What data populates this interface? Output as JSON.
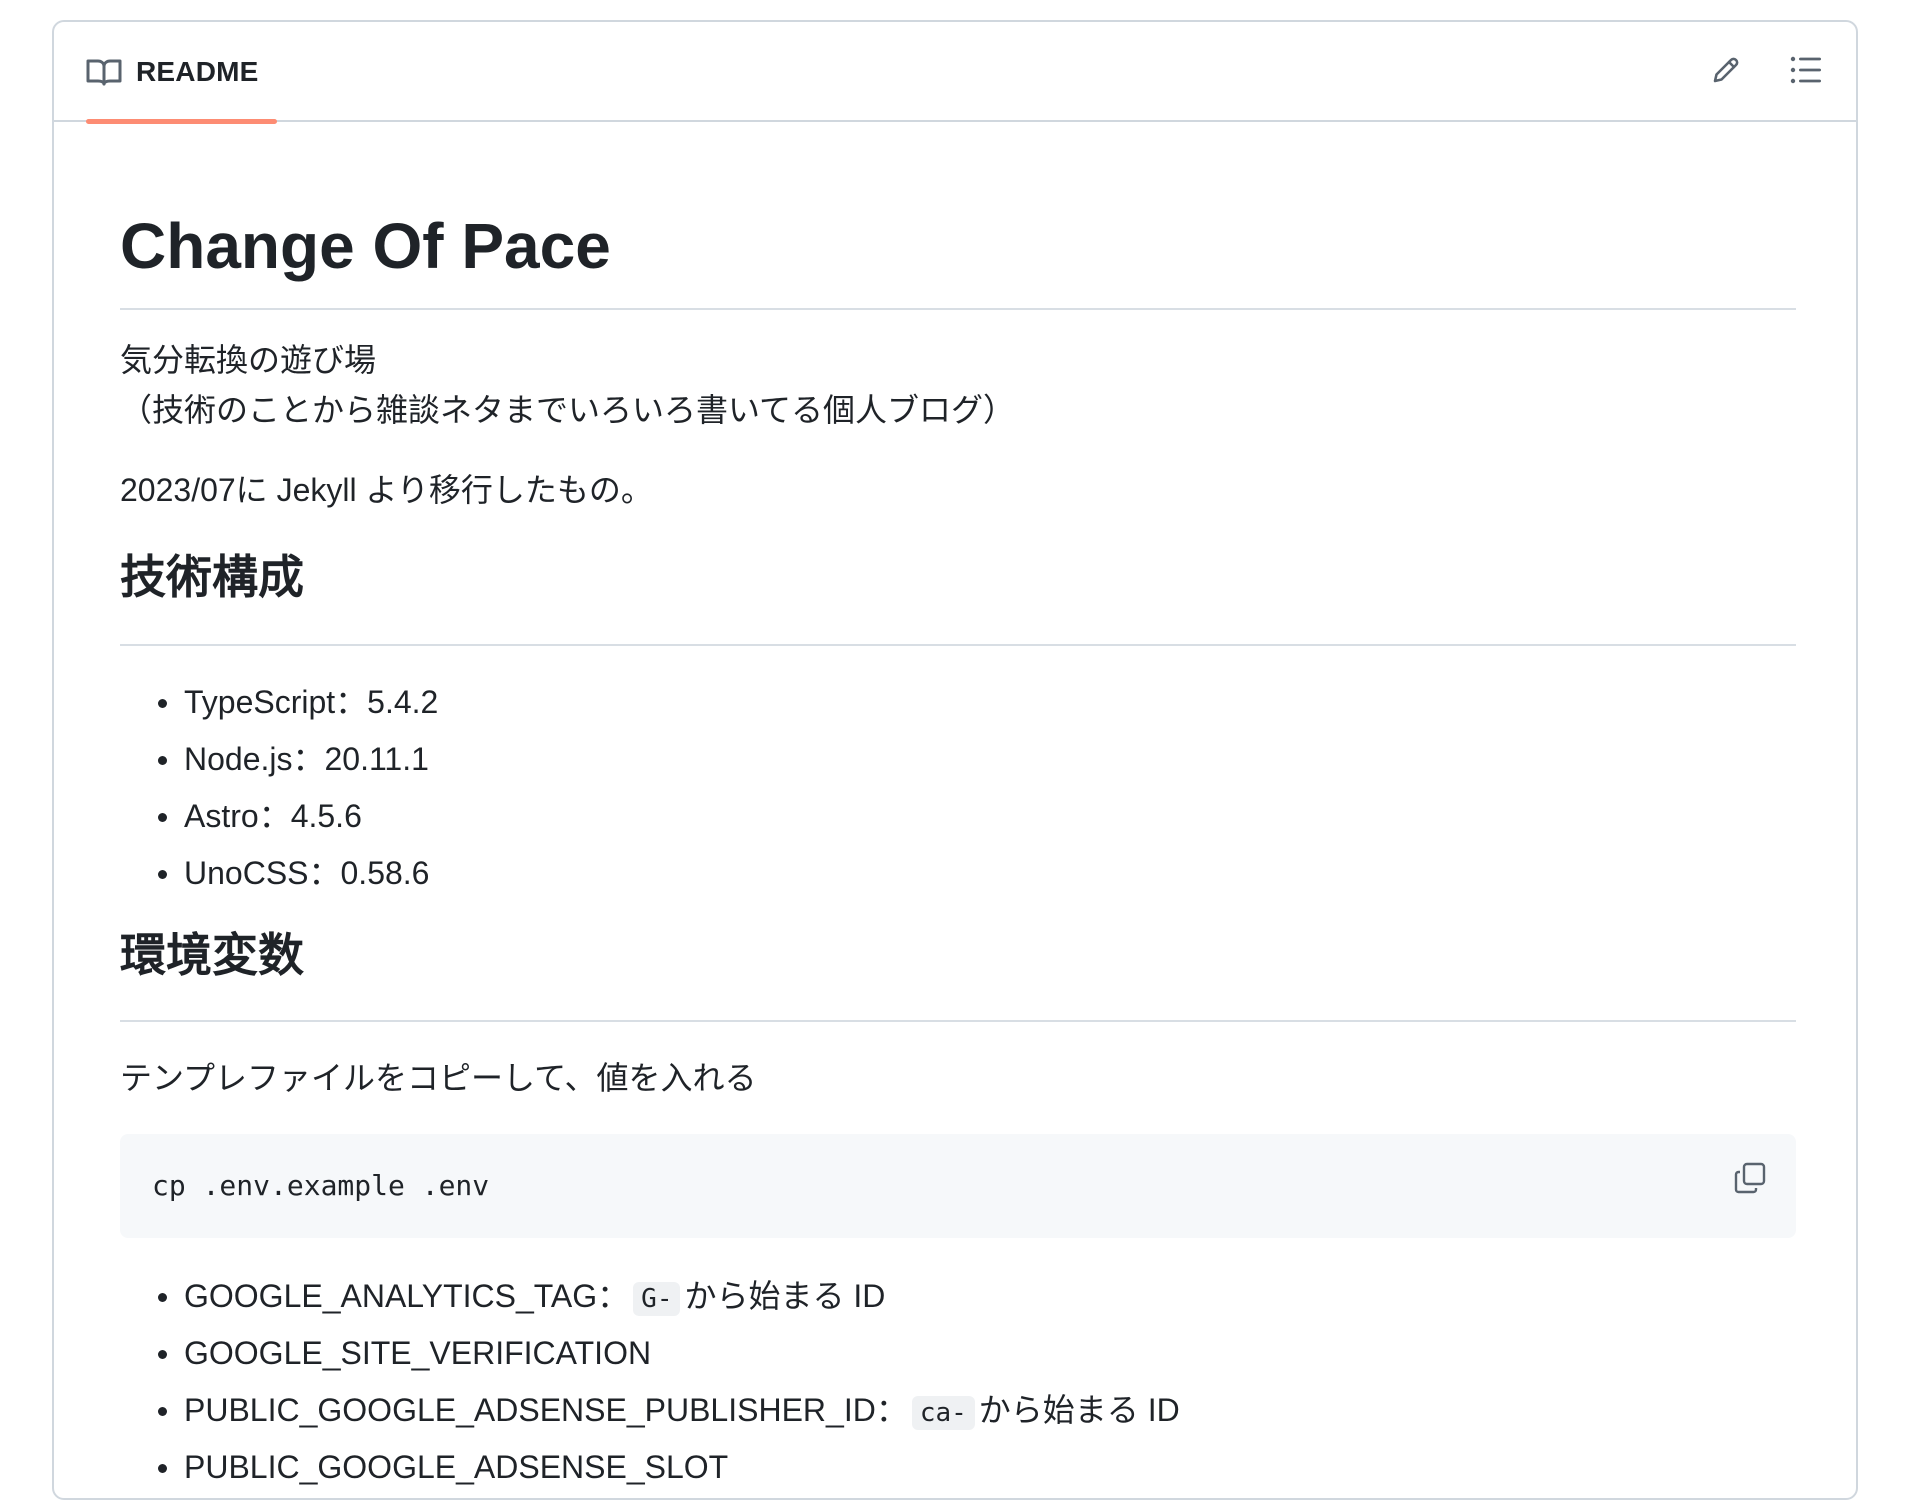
{
  "readme": {
    "tab_label": "README",
    "actions": {
      "edit_icon": "pencil-icon",
      "outline_icon": "list-icon"
    }
  },
  "doc": {
    "title": "Change Of Pace",
    "intro_line1": "気分転換の遊び場",
    "intro_line2": "（技術のことから雑談ネタまでいろいろ書いてる個人ブログ）",
    "migration_note": "2023/07に Jekyll より移行したもの。",
    "tech_heading": "技術構成",
    "tech_items": [
      "TypeScript：5.4.2",
      "Node.js：20.11.1",
      "Astro：4.5.6",
      "UnoCSS：0.58.6"
    ],
    "env_heading": "環境変数",
    "env_intro": "テンプレファイルをコピーして、値を入れる",
    "code": "cp .env.example .env",
    "env_items": [
      {
        "name": "GOOGLE_ANALYTICS_TAG：",
        "code": "G-",
        "suffix": "から始まる ID"
      },
      {
        "name": "GOOGLE_SITE_VERIFICATION",
        "code": "",
        "suffix": ""
      },
      {
        "name": "PUBLIC_GOOGLE_ADSENSE_PUBLISHER_ID：",
        "code": "ca-",
        "suffix": "から始まる ID"
      },
      {
        "name": "PUBLIC_GOOGLE_ADSENSE_SLOT",
        "code": "",
        "suffix": ""
      }
    ]
  },
  "colors": {
    "accent_underline": "#fd8c73",
    "border": "#d0d7de",
    "code_bg": "#f6f8fa",
    "text": "#1f2328",
    "icon": "#59636e"
  }
}
